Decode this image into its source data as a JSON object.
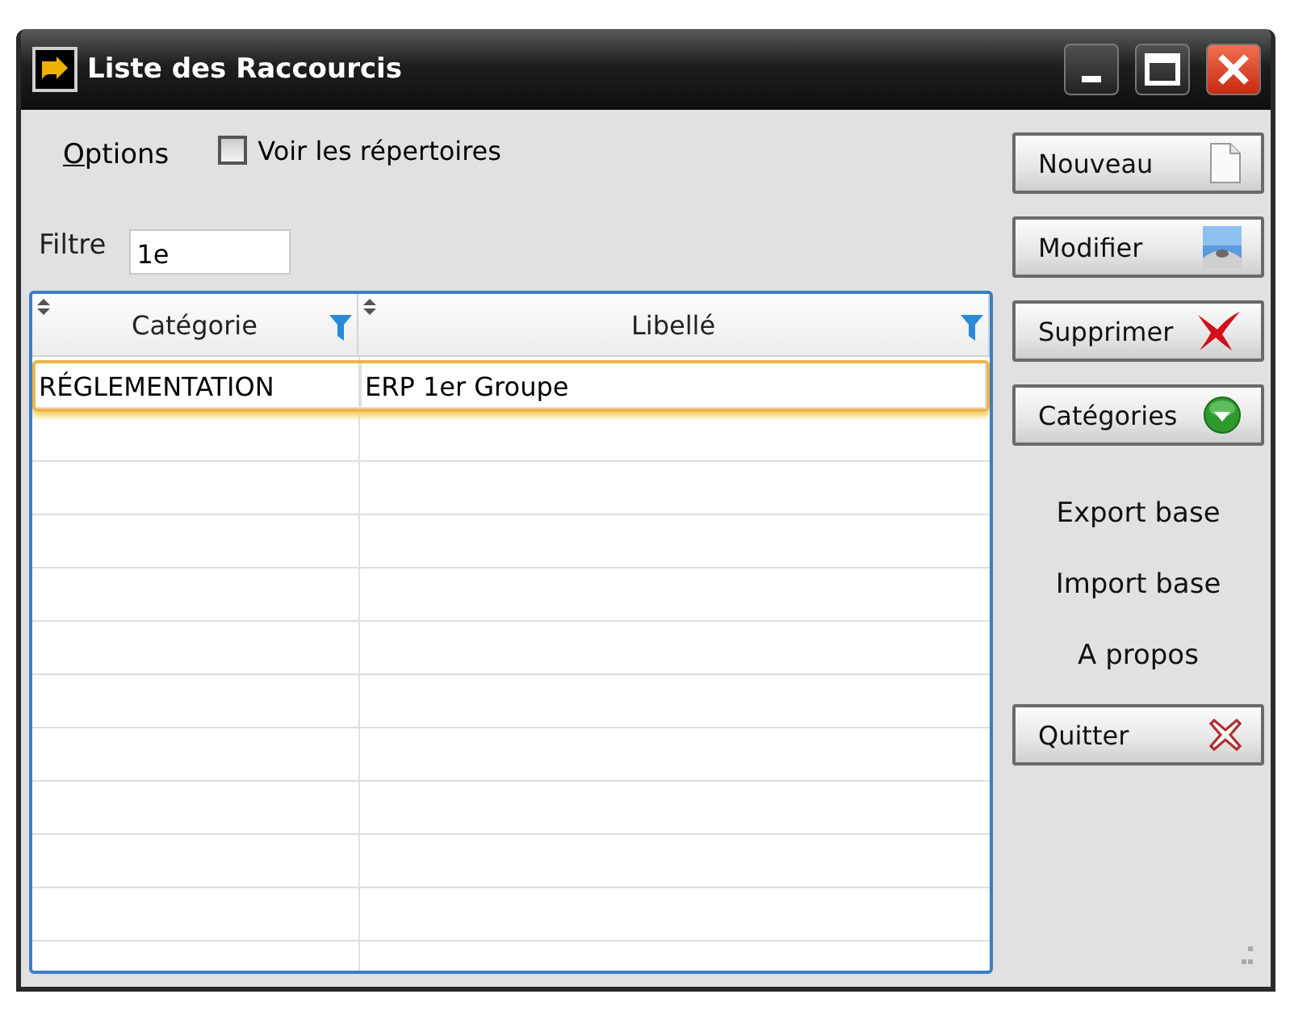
{
  "window": {
    "title": "Liste des Raccourcis"
  },
  "options_menu": "Options",
  "show_folders": {
    "label": "Voir les répertoires",
    "checked": false
  },
  "filter": {
    "label": "Filtre",
    "value": "1e"
  },
  "table": {
    "columns": [
      "Catégorie",
      "Libellé"
    ],
    "rows": [
      {
        "cells": [
          "RÉGLEMENTATION",
          "ERP 1er Groupe"
        ],
        "selected": true
      }
    ]
  },
  "actions": [
    {
      "label": "Nouveau",
      "kind": "button"
    },
    {
      "label": "Modifier",
      "kind": "button"
    },
    {
      "label": "Supprimer",
      "kind": "button"
    },
    {
      "label": "Catégories",
      "kind": "button"
    },
    {
      "label": "Export base",
      "kind": "link"
    },
    {
      "label": "Import base",
      "kind": "link"
    },
    {
      "label": "A propos",
      "kind": "link"
    },
    {
      "label": "Quitter",
      "kind": "button"
    }
  ]
}
